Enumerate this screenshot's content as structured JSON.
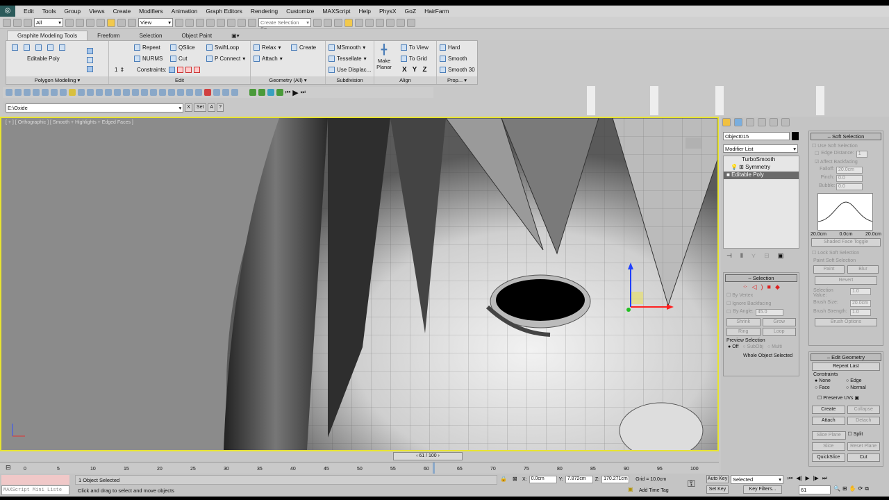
{
  "menu": [
    "Edit",
    "Tools",
    "Group",
    "Views",
    "Create",
    "Modifiers",
    "Animation",
    "Graph Editors",
    "Rendering",
    "Customize",
    "MAXScript",
    "Help",
    "PhysX",
    "GoZ",
    "HairFarm"
  ],
  "toolbar": {
    "filter": "All",
    "ref_coord": "View",
    "named_sel_placeholder": "Create Selection Se"
  },
  "ribbon_tabs": [
    "Graphite Modeling Tools",
    "Freeform",
    "Selection",
    "Object Paint"
  ],
  "ribbon": {
    "polygon_modeling": {
      "label": "Editable Poly",
      "group": "Polygon Modeling"
    },
    "edit": {
      "repeat": "Repeat",
      "qslice": "QSlice",
      "swiftloop": "SwiftLoop",
      "nurms": "NURMS",
      "cut": "Cut",
      "pconnect": "P Connect",
      "constraints": "Constraints:",
      "spinner": "1",
      "group": "Edit"
    },
    "geometry": {
      "relax": "Relax",
      "create": "Create",
      "attach": "Attach",
      "group": "Geometry (All)"
    },
    "subdivision": {
      "msmooth": "MSmooth",
      "tessellate": "Tessellate",
      "use_displac": "Use Displac...",
      "group": "Subdivision"
    },
    "align": {
      "make_planar": "Make Planar",
      "to_view": "To View",
      "to_grid": "To Grid",
      "x": "X",
      "y": "Y",
      "z": "Z",
      "group": "Align"
    },
    "props": {
      "hard": "Hard",
      "smooth": "Smooth",
      "smooth30": "Smooth 30",
      "group": "Prop..."
    }
  },
  "project_path": {
    "value": "E:\\Oxide",
    "x": "X",
    "set": "Set",
    "a": "A",
    "q": "?"
  },
  "viewport": {
    "label": "[ + ] [ Orthographic ] [ Smooth + Highlights + Edged Faces ]"
  },
  "command_panel": {
    "object_name": "Object015",
    "modifier_list": "Modifier List",
    "stack": [
      "TurboSmooth",
      "Symmetry",
      "Editable Poly"
    ],
    "selection": {
      "title": "Selection",
      "by_vertex": "By Vertex",
      "ignore_backfacing": "Ignore Backfacing",
      "by_angle": "By Angle:",
      "angle": "45.0",
      "shrink": "Shrink",
      "grow": "Grow",
      "ring": "Ring",
      "loop": "Loop",
      "preview": "Preview Selection",
      "off": "Off",
      "subobj": "SubObj",
      "multi": "Multi",
      "status": "Whole Object Selected"
    },
    "soft_selection": {
      "title": "Soft Selection",
      "use": "Use Soft Selection",
      "edge_distance": "Edge Distance:",
      "edge_value": "1",
      "affect_backfacing": "Affect Backfacing",
      "falloff": "Falloff:",
      "falloff_value": "20.0cm",
      "pinch": "Pinch:",
      "pinch_value": "0.0",
      "bubble": "Bubble:",
      "bubble_value": "0.0",
      "curve_left": "20.0cm",
      "curve_mid": "0.0cm",
      "curve_right": "20.0cm",
      "shaded_face_toggle": "Shaded Face Toggle",
      "lock": "Lock Soft Selection",
      "paint_group": "Paint Soft Selection",
      "paint": "Paint",
      "blur": "Blur",
      "revert": "Revert",
      "selection_value": "Selection Value:",
      "selection_value_v": "1.0",
      "brush_size": "Brush Size:",
      "brush_size_v": "20.0cm",
      "brush_strength": "Brush Strength:",
      "brush_strength_v": "1.0",
      "brush_options": "Brush Options"
    },
    "edit_geometry": {
      "title": "Edit Geometry",
      "repeat_last": "Repeat Last",
      "constraints": "Constraints",
      "none": "None",
      "edge": "Edge",
      "face": "Face",
      "normal": "Normal",
      "preserve_uvs": "Preserve UVs",
      "create": "Create",
      "collapse": "Collapse",
      "attach": "Attach",
      "detach": "Detach",
      "slice_plane": "Slice Plane",
      "split": "Split",
      "slice": "Slice",
      "reset_plane": "Reset Plane",
      "quickslice": "QuickSlice",
      "cut": "Cut"
    }
  },
  "timeline": {
    "frame": "61 / 100",
    "ticks": [
      "0",
      "5",
      "10",
      "15",
      "20",
      "25",
      "30",
      "35",
      "40",
      "45",
      "50",
      "55",
      "60",
      "65",
      "70",
      "75",
      "80",
      "85",
      "90",
      "95",
      "100"
    ],
    "current": 61,
    "total": 100
  },
  "status": {
    "maxscript": "MAXScript Mini Liste",
    "selected": "1 Object Selected",
    "prompt": "Click and drag to select and move objects",
    "x": "0.0cm",
    "y": "7.872cm",
    "z": "170.271cm",
    "grid": "Grid = 10.0cm",
    "add_time_tag": "Add Time Tag",
    "auto_key": "Auto Key",
    "set_key": "Set Key",
    "key_mode": "Selected",
    "key_filters": "Key Filters...",
    "frame": "61"
  }
}
